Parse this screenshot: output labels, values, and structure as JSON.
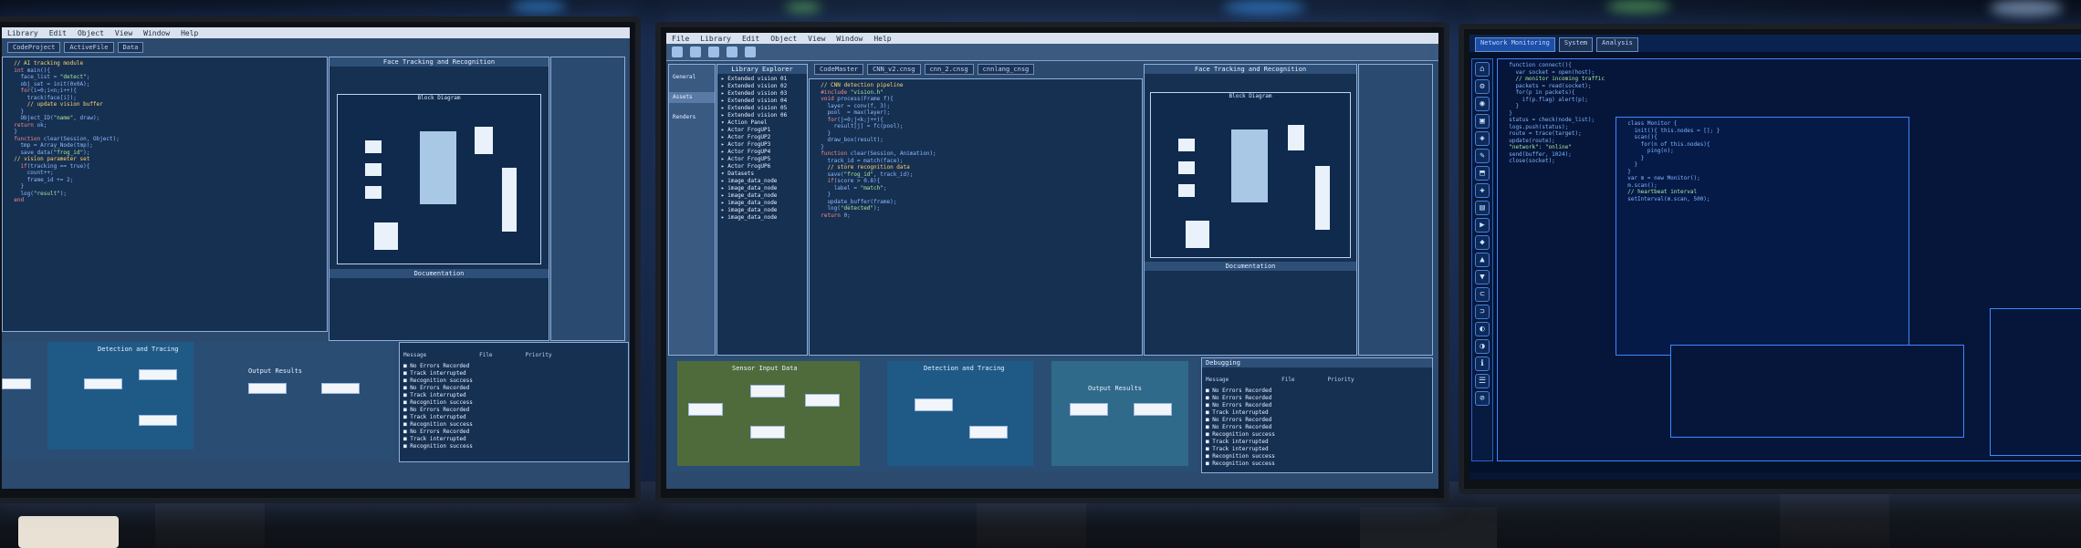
{
  "scene": "Three monitors on a desk displaying software development and network monitoring interfaces",
  "left_monitor": {
    "menu": [
      "Library",
      "Edit",
      "Object",
      "View",
      "Window",
      "Help"
    ],
    "tabs": [
      "CodeProject",
      "ActiveFile",
      "Data"
    ],
    "right_title": "Face Tracking and Recognition",
    "diagram_title": "Block Diagram",
    "doc_title": "Documentation",
    "flow_labels": [
      "Detection and Tracing",
      "Output Results"
    ],
    "log_headers": [
      "Message",
      "File",
      "Priority"
    ],
    "log_rows": [
      "No Errors Recorded",
      "Track interrupted",
      "Recognition success",
      "No Errors Recorded",
      "Track interrupted",
      "Recognition success",
      "No Errors Recorded",
      "Track interrupted",
      "Recognition success",
      "No Errors Recorded",
      "Track interrupted",
      "Recognition success"
    ]
  },
  "center_monitor": {
    "menu": [
      "File",
      "Library",
      "Edit",
      "Object",
      "View",
      "Window",
      "Help"
    ],
    "sidebar": [
      "General",
      "Assets",
      "Renders"
    ],
    "library_title": "Library Explorer",
    "library_items": [
      "Extended vision 01",
      "Extended vision 02",
      "Extended vision 03",
      "Extended vision 04",
      "Extended vision 05",
      "Extended vision 06",
      "Action Panel",
      "Actor FrogUP1",
      "Actor FrogUP2",
      "Actor FrogUP3",
      "Actor FrogUP4",
      "Actor FrogUP5",
      "Actor FrogUP6",
      "Datasets",
      "image_data_node",
      "image_data_node",
      "image_data_node",
      "image_data_node",
      "image_data_node",
      "image_data_node"
    ],
    "tabs": [
      "CodeMaster",
      "CNN_v2.cnsg",
      "cnn_2.cnsg",
      "cnnlang_cnsg"
    ],
    "right_title": "Face Tracking and Recognition",
    "diagram_title": "Block Diagram",
    "doc_title": "Documentation",
    "flow_labels": [
      "Sensor Input Data",
      "Detection and Tracing",
      "Output Results"
    ],
    "log_title": "Debugging",
    "log_headers": [
      "Message",
      "File",
      "Priority"
    ],
    "log_rows": [
      "No Errors Recorded",
      "No Errors Recorded",
      "No Errors Recorded",
      "Track interrupted",
      "No Errors Recorded",
      "No Errors Recorded",
      "Recognition success",
      "Track interrupted",
      "Track interrupted",
      "Recognition success",
      "Recognition success"
    ]
  },
  "right_monitor": {
    "tabs": [
      "Network Monitoring",
      "System",
      "Analysis"
    ],
    "side_icons": [
      "⌂",
      "⚙",
      "◉",
      "▣",
      "◈",
      "✎",
      "⬒",
      "✚",
      "▤",
      "▶",
      "◆",
      "▲",
      "▼",
      "⊂",
      "⊃",
      "◐",
      "◑",
      "ℹ",
      "☰",
      "⊘"
    ]
  }
}
